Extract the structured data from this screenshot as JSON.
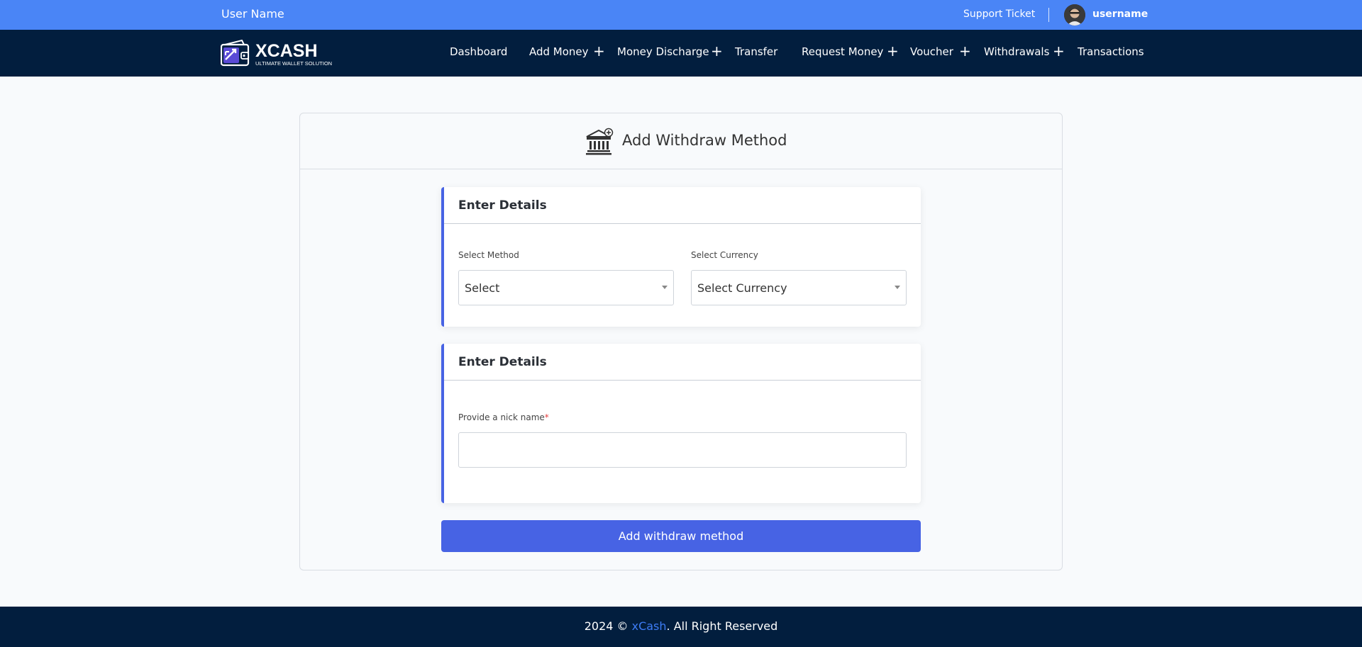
{
  "topbar": {
    "user_name": "User Name",
    "support_label": "Support Ticket",
    "username": "username"
  },
  "brand": {
    "logo_name": "XCASH",
    "logo_tagline": "ULTIMATE WALLET SOLUTION"
  },
  "nav": {
    "items": [
      {
        "label": "Dashboard",
        "has_submenu": false
      },
      {
        "label": "Add Money",
        "has_submenu": true
      },
      {
        "label": "Money Discharge",
        "has_submenu": true
      },
      {
        "label": "Transfer",
        "has_submenu": false
      },
      {
        "label": "Request Money",
        "has_submenu": true
      },
      {
        "label": "Voucher",
        "has_submenu": true
      },
      {
        "label": "Withdrawals",
        "has_submenu": true
      },
      {
        "label": "Transactions",
        "has_submenu": false
      }
    ],
    "submenu_glyph": "+"
  },
  "page": {
    "title": "Add Withdraw Method",
    "icon": "bank-plus-icon"
  },
  "section1": {
    "title": "Enter Details",
    "method_label": "Select Method",
    "method_value": "Select",
    "currency_label": "Select Currency",
    "currency_value": "Select Currency"
  },
  "section2": {
    "title": "Enter Details",
    "nickname_label": "Provide a nick name",
    "required_mark": "*",
    "nickname_value": ""
  },
  "submit_label": "Add withdraw method",
  "footer": {
    "prefix": "2024 © ",
    "brand": "xCash",
    "suffix": ". All Right Reserved"
  },
  "colors": {
    "topbar": "#4a85f6",
    "navbar": "#021e3e",
    "accent": "#4763e4",
    "footer_brand": "#3d7cf5"
  }
}
